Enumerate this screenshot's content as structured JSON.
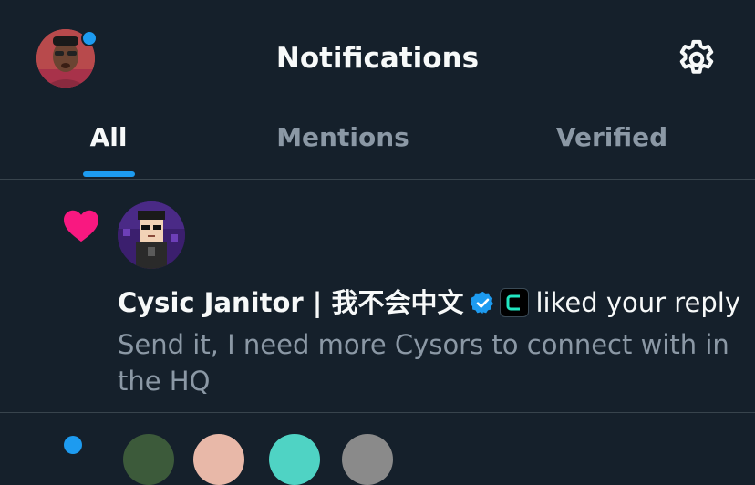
{
  "header": {
    "title": "Notifications",
    "settings_icon": "gear-icon",
    "has_unread_dot": true,
    "accent_color": "#1d9bf0"
  },
  "tabs": [
    {
      "label": "All",
      "active": true
    },
    {
      "label": "Mentions",
      "active": false
    },
    {
      "label": "Verified",
      "active": false
    }
  ],
  "notification": {
    "type_icon": "heart-icon",
    "type_color": "#f91880",
    "actor_name": "Cysic Janitor | 我不会中文",
    "verified": true,
    "verified_icon": "verified-badge-icon",
    "affiliate_icon": "cysic-logo-icon",
    "action": "liked your reply",
    "reply_text": "Send it, I need more Cysors to connect with in the HQ"
  }
}
